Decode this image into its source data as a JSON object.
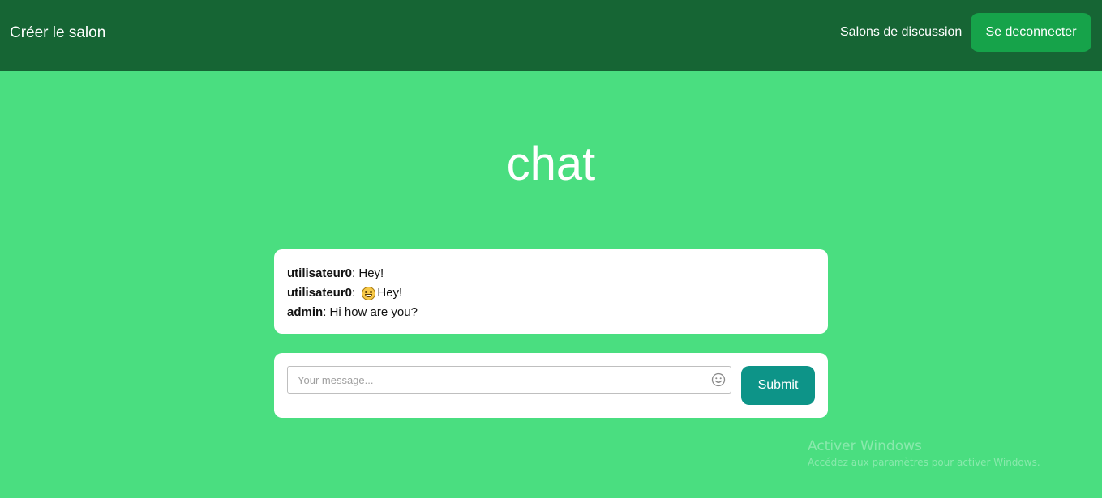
{
  "navbar": {
    "brand": "Créer le salon",
    "rooms_link": "Salons de discussion",
    "logout_label": "Se deconnecter"
  },
  "page": {
    "title": "chat"
  },
  "messages": [
    {
      "author": "utilisateur0",
      "separator": ": ",
      "text": "Hey!",
      "emoji": ""
    },
    {
      "author": "utilisateur0",
      "separator": ": ",
      "text": "Hey!",
      "emoji": "grinning-face"
    },
    {
      "author": "admin",
      "separator": ": ",
      "text": "Hi how are you?",
      "emoji": ""
    }
  ],
  "composer": {
    "placeholder": "Your message...",
    "value": "",
    "submit_label": "Submit",
    "emoji_icon": "smiley-icon"
  },
  "watermark": {
    "title": "Activer Windows",
    "subtitle": "Accédez aux paramètres pour activer Windows."
  },
  "colors": {
    "background": "#4ade80",
    "navbar": "#166534",
    "logout_button": "#16a34a",
    "submit_button": "#0d9488"
  }
}
